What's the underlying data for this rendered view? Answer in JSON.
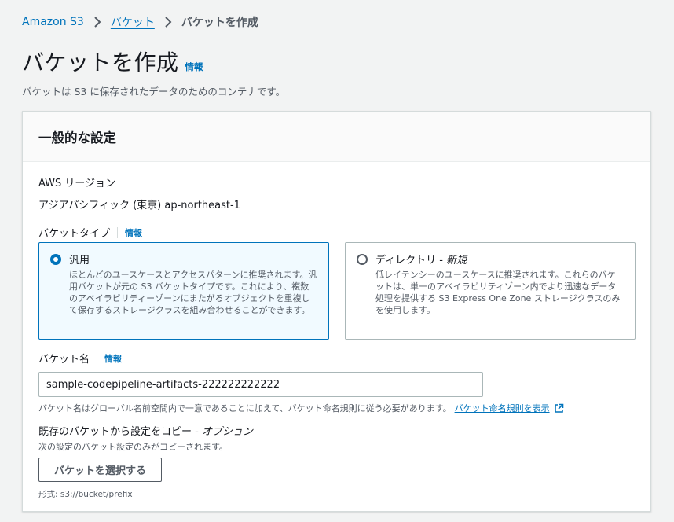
{
  "breadcrumb": {
    "items": [
      "Amazon S3",
      "バケット"
    ],
    "current": "バケットを作成"
  },
  "header": {
    "title": "バケットを作成",
    "info": "情報",
    "description": "バケットは S3 に保存されたデータのためのコンテナです。"
  },
  "general": {
    "title": "一般的な設定",
    "region_label": "AWS リージョン",
    "region_value": "アジアパシフィック (東京) ap-northeast-1",
    "bucket_type_label": "バケットタイプ",
    "info": "情報",
    "tiles": [
      {
        "title": "汎用",
        "title_suffix": "",
        "selected": true,
        "description": "ほとんどのユースケースとアクセスパターンに推奨されます。汎用バケットが元の S3 バケットタイプです。これにより、複数のアベイラビリティーゾーンにまたがるオブジェクトを重複して保存するストレージクラスを組み合わせることができます。"
      },
      {
        "title": "ディレクトリ - ",
        "title_suffix": "新規",
        "selected": false,
        "description": "低レイテンシーのユースケースに推奨されます。これらのバケットは、単一のアベイラビリティゾーン内でより迅速なデータ処理を提供する S3 Express One Zone ストレージクラスのみを使用します。"
      }
    ],
    "bucket_name_label": "バケット名",
    "bucket_name_value": "sample-codepipeline-artifacts-222222222222",
    "bucket_name_hint": "バケット名はグローバル名前空間内で一意であることに加えて、バケット命名規則に従う必要があります。",
    "naming_rules_link": "バケット命名規則を表示",
    "copy_title": "既存のバケットから設定をコピー - ",
    "copy_title_optional": "オプション",
    "copy_desc": "次の設定のバケット設定のみがコピーされます。",
    "choose_button": "バケットを選択する",
    "format": "形式: s3://bucket/prefix"
  },
  "colors": {
    "link": "#0073bb",
    "background": "#f2f3f3",
    "selected_tile": "#f1faff"
  }
}
